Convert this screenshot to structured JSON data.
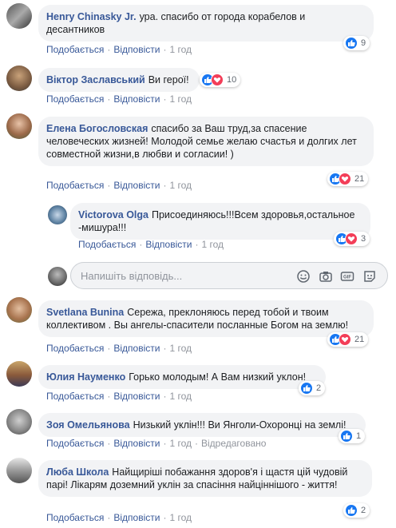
{
  "comments": [
    {
      "author": "Henry Chinasky Jr.",
      "text": "ура. спасибо от города корабелов и десантников",
      "like": "Подобається",
      "reply": "Відповісти",
      "time": "1 год",
      "reactions": "9"
    },
    {
      "author": "Віктор Заславський",
      "text": "Ви герої!",
      "like": "Подобається",
      "reply": "Відповісти",
      "time": "1 год",
      "reactions": "10"
    },
    {
      "author": "Елена Богословская",
      "text": "спасибо за Ваш труд,за спасение человеческих жизней! Молодой семье желаю счастья и долгих лет совместной жизни,в любви и согласии! )",
      "like": "Подобається",
      "reply": "Відповісти",
      "time": "1 год",
      "reactions": "21"
    },
    {
      "author": "Victorova Olga",
      "text": "Присоединяюсь!!!Всем здоровья,остальное -мишура!!!",
      "like": "Подобається",
      "reply": "Відповісти",
      "time": "1 год",
      "reactions": "3"
    },
    {
      "author": "Svetlana Bunina",
      "text": "Сережа, преклоняюсь перед тобой и твоим коллективом . Вы ангелы-спасители посланные Богом на землю!",
      "like": "Подобається",
      "reply": "Відповісти",
      "time": "1 год",
      "reactions": "21"
    },
    {
      "author": "Юлия Науменко",
      "text": "Горько молодым! А Вам низкий уклон!",
      "like": "Подобається",
      "reply": "Відповісти",
      "time": "1 год",
      "reactions": "2"
    },
    {
      "author": "Зоя Омельянова",
      "text": "Низький уклін!!! Ви Янголи-Охоронці на землі!",
      "like": "Подобається",
      "reply": "Відповісти",
      "time": "1 год",
      "edited": "Відредаговано",
      "reactions": "1"
    },
    {
      "author": "Люба Школа",
      "text": "Найщиріші побажання здоров'я і щастя цій чудовій парі! Лікарям доземний уклін за спасіння найцінні­шого - життя!",
      "like": "Подобається",
      "reply": "Відповісти",
      "time": "1 год",
      "reactions": "2"
    }
  ],
  "reply_input": {
    "placeholder": "Напишіть відповідь..."
  },
  "colors": {
    "link": "#385898",
    "bubble": "#f2f3f5",
    "like": "#1877f2",
    "love": "#f33e58"
  }
}
